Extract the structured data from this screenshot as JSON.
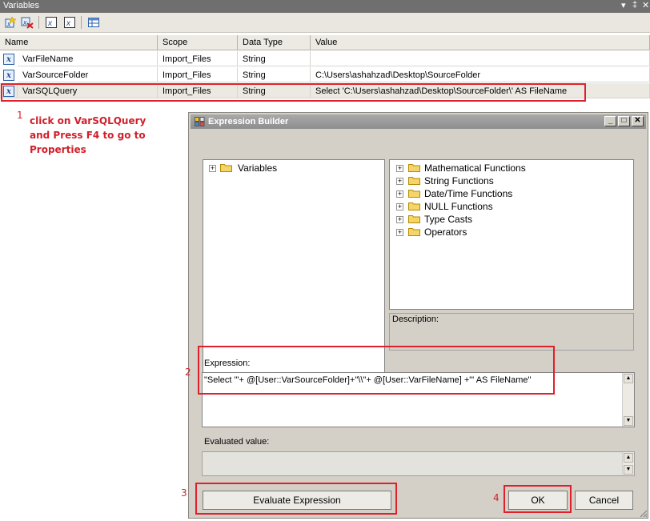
{
  "variables_window": {
    "title": "Variables",
    "pin_icons": [
      "▾",
      "‡",
      "✕"
    ],
    "toolbar_icons": [
      "add-variable-icon",
      "delete-variable-icon",
      "show-system-variables-icon",
      "show-all-variables-icon",
      "choose-columns-icon"
    ],
    "columns": [
      "Name",
      "Scope",
      "Data Type",
      "Value"
    ],
    "rows": [
      {
        "name": "VarFileName",
        "scope": "Import_Files",
        "type": "String",
        "value": ""
      },
      {
        "name": "VarSourceFolder",
        "scope": "Import_Files",
        "type": "String",
        "value": "C:\\Users\\ashahzad\\Desktop\\SourceFolder"
      },
      {
        "name": "VarSQLQuery",
        "scope": "Import_Files",
        "type": "String",
        "value": "Select 'C:\\Users\\ashahzad\\Desktop\\SourceFolder\\' AS FileName"
      }
    ]
  },
  "annotations": {
    "step1_number": "1",
    "step1_text": [
      "click on VarSQLQuery",
      "and Press F4 to go to",
      "Properties"
    ],
    "step2_number": "2",
    "step3_number": "3",
    "step4_number": "4",
    "color": "#d11f2a"
  },
  "dialog": {
    "title": "Expression Builder",
    "left_tree": [
      {
        "label": "Variables"
      }
    ],
    "right_tree": [
      {
        "label": "Mathematical Functions"
      },
      {
        "label": "String Functions"
      },
      {
        "label": "Date/Time Functions"
      },
      {
        "label": "NULL Functions"
      },
      {
        "label": "Type Casts"
      },
      {
        "label": "Operators"
      }
    ],
    "description_label": "Description:",
    "expression_label": "Expression:",
    "expression_value": "\"Select '\"+ @[User::VarSourceFolder]+\"\\\\\"+ @[User::VarFileName] +\"' AS FileName\"",
    "evaluated_label": "Evaluated value:",
    "evaluated_value": "",
    "evaluate_button": "Evaluate Expression",
    "ok_button": "OK",
    "cancel_button": "Cancel",
    "window_buttons": [
      "_",
      "□",
      "✕"
    ]
  }
}
